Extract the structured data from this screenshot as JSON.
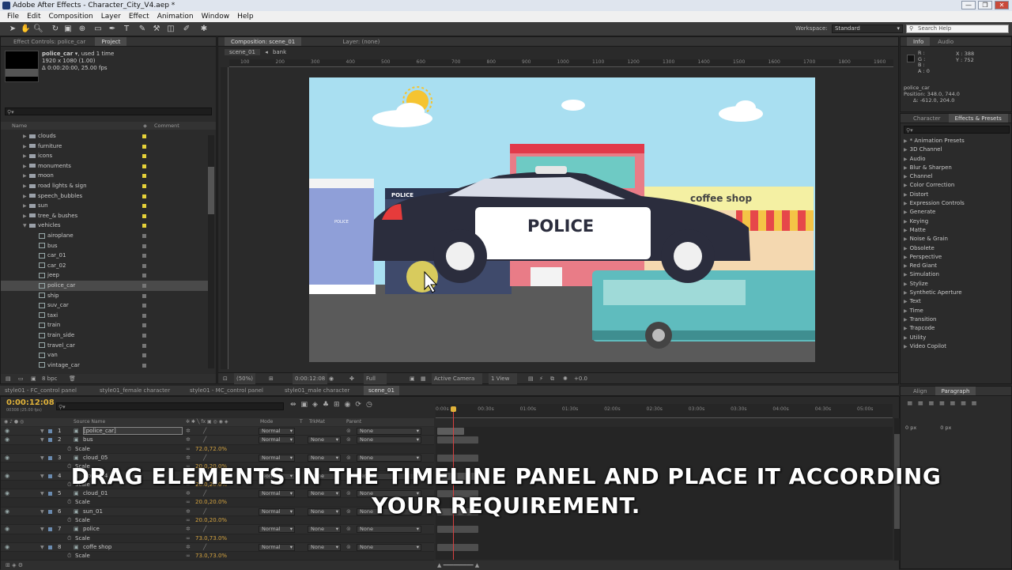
{
  "window": {
    "title": "Adobe After Effects - Character_City_V4.aep *",
    "controls": [
      "—",
      "❐",
      "✕"
    ]
  },
  "menu": [
    "File",
    "Edit",
    "Composition",
    "Layer",
    "Effect",
    "Animation",
    "Window",
    "Help"
  ],
  "toolbar": {
    "workspace_label": "Workspace:",
    "workspace_value": "Standard",
    "search_placeholder": "Search Help"
  },
  "project": {
    "tabs": [
      "Effect Controls: police_car",
      "Project"
    ],
    "item_name": "police_car ▾",
    "item_used": ", used 1 time",
    "item_size": "1920 x 1080 (1.00)",
    "item_duration": "Δ 0:00:20:00, 25.00 fps",
    "col_name": "Name",
    "col_comment": "Comment",
    "items": [
      {
        "label": "clouds",
        "type": "folder",
        "open": false,
        "color": "yellow"
      },
      {
        "label": "furniture",
        "type": "folder",
        "open": false,
        "color": "yellow"
      },
      {
        "label": "icons",
        "type": "folder",
        "open": false,
        "color": "yellow"
      },
      {
        "label": "monuments",
        "type": "folder",
        "open": false,
        "color": "yellow"
      },
      {
        "label": "moon",
        "type": "folder",
        "open": false,
        "color": "yellow"
      },
      {
        "label": "road lights & sign",
        "type": "folder",
        "open": false,
        "color": "yellow"
      },
      {
        "label": "speech_bubbles",
        "type": "folder",
        "open": false,
        "color": "yellow"
      },
      {
        "label": "sun",
        "type": "folder",
        "open": false,
        "color": "yellow"
      },
      {
        "label": "tree_& bushes",
        "type": "folder",
        "open": false,
        "color": "yellow"
      },
      {
        "label": "vehicles",
        "type": "folder",
        "open": true,
        "color": "yellow"
      },
      {
        "label": "airoplane",
        "type": "comp",
        "color": "gray"
      },
      {
        "label": "bus",
        "type": "comp",
        "color": "gray"
      },
      {
        "label": "car_01",
        "type": "comp",
        "color": "gray"
      },
      {
        "label": "car_02",
        "type": "comp",
        "color": "gray"
      },
      {
        "label": "jeep",
        "type": "comp",
        "color": "gray"
      },
      {
        "label": "police_car",
        "type": "comp",
        "color": "gray",
        "selected": true
      },
      {
        "label": "ship",
        "type": "comp",
        "color": "gray"
      },
      {
        "label": "suv_car",
        "type": "comp",
        "color": "gray"
      },
      {
        "label": "taxi",
        "type": "comp",
        "color": "gray"
      },
      {
        "label": "train",
        "type": "comp",
        "color": "gray"
      },
      {
        "label": "train_side",
        "type": "comp",
        "color": "gray"
      },
      {
        "label": "travel_car",
        "type": "comp",
        "color": "gray"
      },
      {
        "label": "van",
        "type": "comp",
        "color": "gray"
      },
      {
        "label": "vintage_car",
        "type": "comp",
        "color": "gray"
      }
    ],
    "bpc": "8 bpc"
  },
  "composition": {
    "tabs": [
      "Composition: scene_01",
      "Layer: (none)"
    ],
    "crumbs": [
      "scene_01",
      "bank"
    ],
    "ruler": [
      "100",
      "200",
      "300",
      "400",
      "500",
      "600",
      "700",
      "800",
      "900",
      "1000",
      "1100",
      "1200",
      "1300",
      "1400",
      "1500",
      "1600",
      "1700",
      "1800",
      "1900"
    ],
    "footer": {
      "zoom": "(50%)",
      "time": "0:00:12:08",
      "resolution": "Full",
      "camera": "Active Camera",
      "view": "1 View",
      "exposure": "+0.0"
    },
    "scene": {
      "coffee_shop_sign": "coffee shop",
      "police_text": "POLICE",
      "police_small": "POLICE",
      "police_building": "POLICE"
    }
  },
  "info": {
    "tabs": [
      "Info",
      "Audio"
    ],
    "r": "R :",
    "g": "G :",
    "b": "B :",
    "a": "A : 0",
    "x": "X : 388",
    "y": "Y : 752",
    "layer": "police_car",
    "position": "Position: 348.0, 744.0",
    "delta": "Δ: -612.0, 204.0"
  },
  "effects": {
    "tabs": [
      "Character",
      "Effects & Presets"
    ],
    "items": [
      "* Animation Presets",
      "3D Channel",
      "Audio",
      "Blur & Sharpen",
      "Channel",
      "Color Correction",
      "Distort",
      "Expression Controls",
      "Generate",
      "Keying",
      "Matte",
      "Noise & Grain",
      "Obsolete",
      "Perspective",
      "Red Giant",
      "Simulation",
      "Stylize",
      "Synthetic Aperture",
      "Text",
      "Time",
      "Transition",
      "Trapcode",
      "Utility",
      "Video Copilot"
    ]
  },
  "timeline": {
    "tabs": [
      "style01 - FC_control panel",
      "style01_female character",
      "style01 - MC_control panel",
      "style01_male character",
      "scene_01"
    ],
    "timecode": "0:00:12:08",
    "fps": "00308 (25.00 fps)",
    "col_source": "Source Name",
    "col_mode": "Mode",
    "col_trkmat": "TrkMat",
    "col_parent": "Parent",
    "ruler": [
      "0:00s",
      "00:30s",
      "01:00s",
      "01:30s",
      "02:00s",
      "02:30s",
      "03:00s",
      "03:30s",
      "04:00s",
      "04:30s",
      "05:00s"
    ],
    "rows": [
      {
        "kind": "layer",
        "num": "1",
        "name": "[police_car]",
        "mode": "Normal",
        "trk": "",
        "parent": "None",
        "selected": true
      },
      {
        "kind": "layer",
        "num": "2",
        "name": "bus",
        "mode": "Normal",
        "trk": "None",
        "parent": "None"
      },
      {
        "kind": "prop",
        "name": "Scale",
        "value": "72.0,72.0%"
      },
      {
        "kind": "layer",
        "num": "3",
        "name": "cloud_05",
        "mode": "Normal",
        "trk": "None",
        "parent": "None"
      },
      {
        "kind": "prop",
        "name": "Scale",
        "value": "20.0,20.0%"
      },
      {
        "kind": "layer",
        "num": "4",
        "name": "cloud_04",
        "mode": "Normal",
        "trk": "None",
        "parent": "None"
      },
      {
        "kind": "prop",
        "name": "Scale",
        "value": "20.0,20.0%"
      },
      {
        "kind": "layer",
        "num": "5",
        "name": "cloud_01",
        "mode": "Normal",
        "trk": "None",
        "parent": "None"
      },
      {
        "kind": "prop",
        "name": "Scale",
        "value": "20.0,20.0%"
      },
      {
        "kind": "layer",
        "num": "6",
        "name": "sun_01",
        "mode": "Normal",
        "trk": "None",
        "parent": "None"
      },
      {
        "kind": "prop",
        "name": "Scale",
        "value": "20.0,20.0%"
      },
      {
        "kind": "layer",
        "num": "7",
        "name": "police",
        "mode": "Normal",
        "trk": "None",
        "parent": "None"
      },
      {
        "kind": "prop",
        "name": "Scale",
        "value": "73.0,73.0%"
      },
      {
        "kind": "layer",
        "num": "8",
        "name": "coffe shop",
        "mode": "Normal",
        "trk": "None",
        "parent": "None"
      },
      {
        "kind": "prop",
        "name": "Scale",
        "value": "73.0,73.0%"
      }
    ]
  },
  "align": {
    "tabs": [
      "Align",
      "Paragraph"
    ],
    "px1": "0 px",
    "px2": "0 px"
  },
  "caption": {
    "line1": "DRAG ELEMENTS IN THE TIMELINE PANEL AND PLACE IT ACCORDING",
    "line2": "YOUR REQUIREMENT."
  }
}
